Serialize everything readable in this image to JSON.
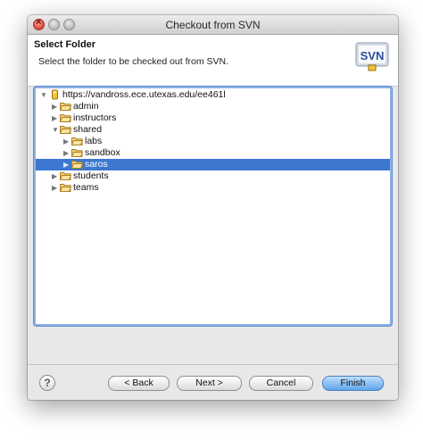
{
  "window": {
    "title": "Checkout from SVN"
  },
  "header": {
    "title": "Select Folder",
    "description": "Select the folder to be checked out from SVN.",
    "logo_text": "SVN"
  },
  "tree": {
    "root": {
      "label": "https://vandross.ece.utexas.edu/ee461l",
      "expanded": true
    },
    "items": [
      {
        "label": "admin",
        "expanded": false,
        "selected": false
      },
      {
        "label": "instructors",
        "expanded": false,
        "selected": false
      },
      {
        "label": "shared",
        "expanded": true,
        "selected": false
      },
      {
        "label": "labs",
        "expanded": false,
        "selected": false
      },
      {
        "label": "sandbox",
        "expanded": false,
        "selected": false
      },
      {
        "label": "saros",
        "expanded": false,
        "selected": true
      },
      {
        "label": "students",
        "expanded": false,
        "selected": false
      },
      {
        "label": "teams",
        "expanded": false,
        "selected": false
      }
    ]
  },
  "buttons": {
    "help": "?",
    "back": "< Back",
    "next": "Next >",
    "cancel": "Cancel",
    "finish": "Finish"
  },
  "colors": {
    "selection": "#3c78d0",
    "focus_ring": "#8db2e3",
    "default_button": "#5ea5ec"
  }
}
